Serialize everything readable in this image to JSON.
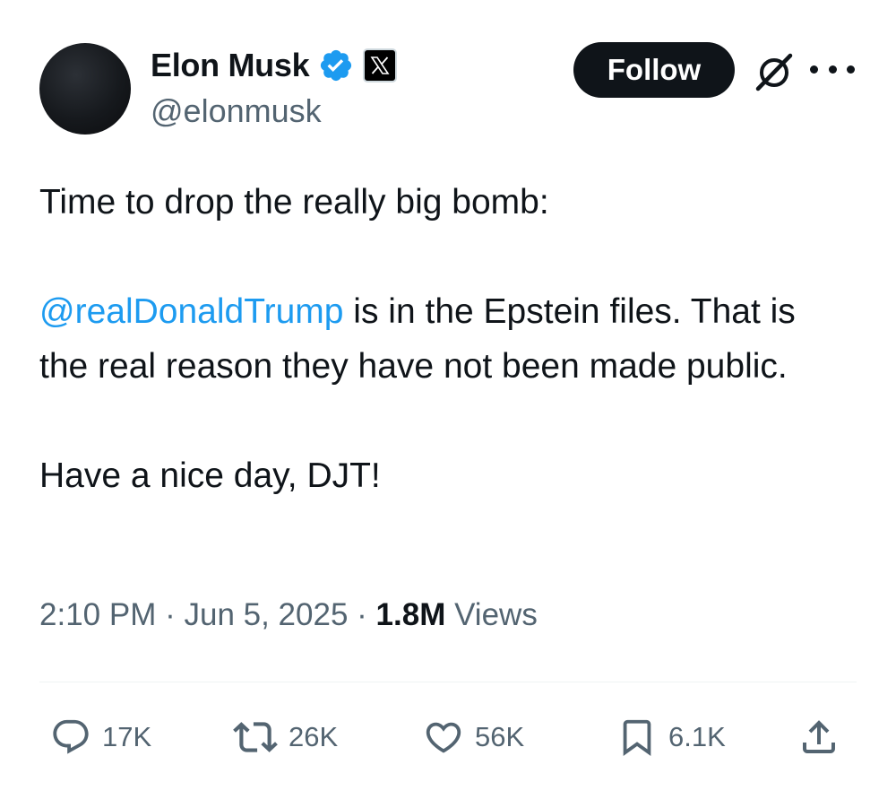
{
  "author": {
    "display_name": "Elon Musk",
    "handle": "@elonmusk",
    "verified_icon": "verified-badge-icon",
    "affiliate_icon": "x-logo-icon"
  },
  "header": {
    "follow_label": "Follow",
    "grok_icon": "grok-icon",
    "more_icon": "more-options-icon"
  },
  "tweet": {
    "line1": "Time to drop the really big bomb:",
    "mention": "@realDonaldTrump",
    "line2_rest": " is in the Epstein files. That is the real reason they have not been made public.",
    "line3": "Have a nice day, DJT!"
  },
  "meta": {
    "time": "2:10 PM",
    "separator": "·",
    "date": "Jun 5, 2025",
    "views_count": "1.8M",
    "views_label": "Views"
  },
  "actions": {
    "reply_count": "17K",
    "repost_count": "26K",
    "like_count": "56K",
    "bookmark_count": "6.1K"
  },
  "colors": {
    "link": "#1d9bf0",
    "verified": "#1d9bf0",
    "text": "#0f1419",
    "secondary": "#536471"
  }
}
